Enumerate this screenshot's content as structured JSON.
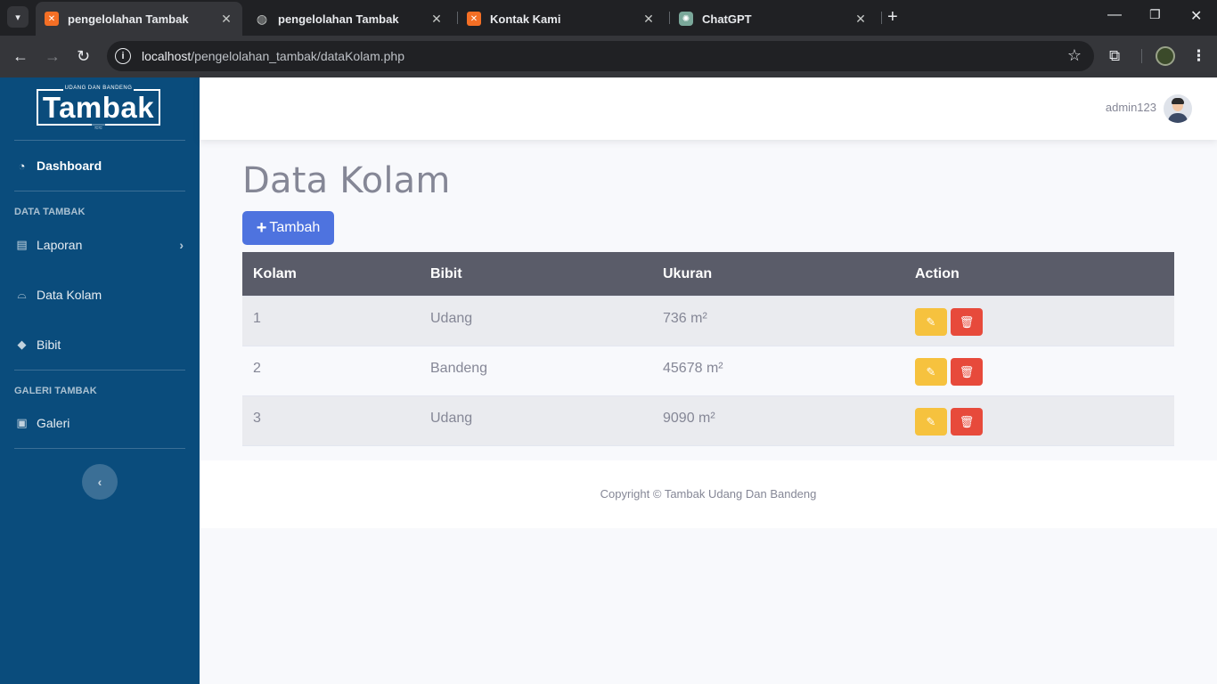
{
  "browser": {
    "tabs": [
      {
        "title": "pengelolahan Tambak",
        "icon": "xampp-icon",
        "active": true
      },
      {
        "title": "pengelolahan Tambak",
        "icon": "globe-icon",
        "active": false
      },
      {
        "title": "Kontak Kami",
        "icon": "xampp-icon",
        "active": false
      },
      {
        "title": "ChatGPT",
        "icon": "chatgpt-icon",
        "active": false
      }
    ],
    "url_host": "localhost",
    "url_path": "/pengelolahan_tambak/dataKolam.php"
  },
  "sidebar": {
    "brand_small": "UDANG DAN BANDENG",
    "brand_name": "Tambak",
    "dashboard": "Dashboard",
    "heading_data": "DATA TAMBAK",
    "laporan": "Laporan",
    "data_kolam": "Data Kolam",
    "bibit": "Bibit",
    "heading_galeri": "GALERI TAMBAK",
    "galeri": "Galeri"
  },
  "topbar": {
    "username": "admin123"
  },
  "main": {
    "title": "Data Kolam",
    "add_button": "Tambah",
    "table": {
      "headers": [
        "Kolam",
        "Bibit",
        "Ukuran",
        "Action"
      ],
      "rows": [
        {
          "kolam": "1",
          "bibit": "Udang",
          "ukuran": "736 m²"
        },
        {
          "kolam": "2",
          "bibit": "Bandeng",
          "ukuran": "45678 m²"
        },
        {
          "kolam": "3",
          "bibit": "Udang",
          "ukuran": "9090 m²"
        }
      ]
    }
  },
  "footer": {
    "copyright": "Copyright © Tambak Udang Dan Bandeng"
  },
  "colors": {
    "sidebar": "#0a4c7c",
    "primary": "#4e73df",
    "warning": "#f6c23e",
    "danger": "#e74a3b",
    "table_header": "#5a5c69"
  }
}
